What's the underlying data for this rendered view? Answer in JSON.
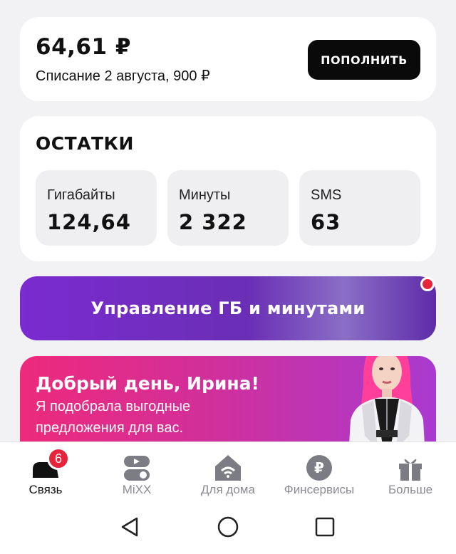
{
  "balance": {
    "amount": "64,61 ₽",
    "charge_info": "Списание 2 августа, 900 ₽",
    "topup_label": "ПОПОЛНИТЬ"
  },
  "remains": {
    "title": "ОСТАТКИ",
    "tiles": [
      {
        "label": "Гигабайты",
        "value": "124,64"
      },
      {
        "label": "Минуты",
        "value": "2 322"
      },
      {
        "label": "SMS",
        "value": "63"
      }
    ]
  },
  "manage_banner": {
    "label": "Управление ГБ и минутами"
  },
  "greeting": {
    "title": "Добрый день, Ирина!",
    "text": "Я подобрала выгодные предложения для вас."
  },
  "nav": {
    "items": [
      {
        "label": "Связь",
        "icon": "connection-icon",
        "active": true,
        "badge": "6"
      },
      {
        "label": "MiXX",
        "icon": "mixx-icon",
        "active": false
      },
      {
        "label": "Для дома",
        "icon": "home-wifi-icon",
        "active": false
      },
      {
        "label": "Финсервисы",
        "icon": "ruble-icon",
        "active": false
      },
      {
        "label": "Больше",
        "icon": "gift-icon",
        "active": false
      }
    ]
  },
  "colors": {
    "accent_dark": "#0a0a0a",
    "banner_purple": "#7b2bd0",
    "banner_pink": "#ee2a7b",
    "badge_red": "#e8243c"
  }
}
